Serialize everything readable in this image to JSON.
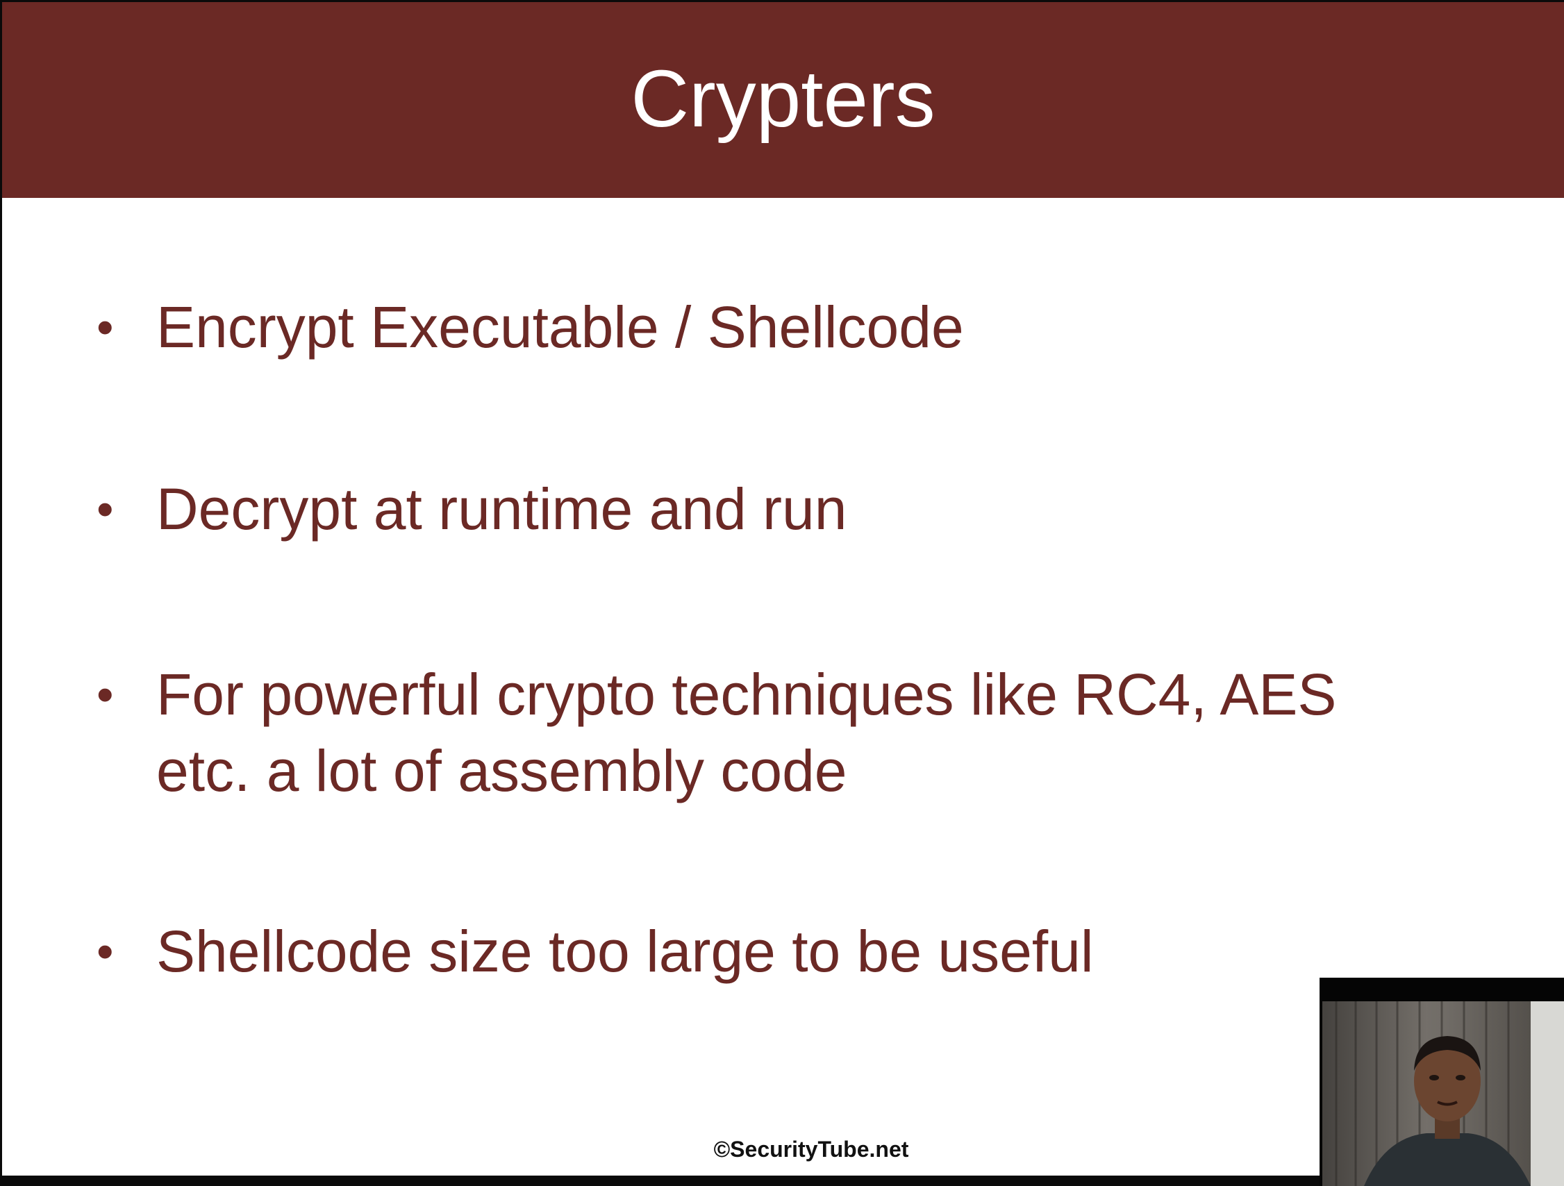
{
  "slide": {
    "title": "Crypters",
    "bullets": [
      {
        "lines": [
          "Encrypt Executable / Shellcode"
        ]
      },
      {
        "lines": [
          "Decrypt at runtime and run"
        ]
      },
      {
        "lines": [
          "For powerful crypto techniques like RC4, AES",
          "etc. a lot of assembly code"
        ]
      },
      {
        "lines": [
          "Shellcode size too large to be useful"
        ]
      }
    ],
    "bullet_glyph": "•",
    "footer": "©SecurityTube.net"
  },
  "colors": {
    "title_bar": "#6b2925",
    "text": "#6b2925",
    "background": "#ffffff"
  },
  "webcam": {
    "icon": "presenter-video-feed"
  }
}
